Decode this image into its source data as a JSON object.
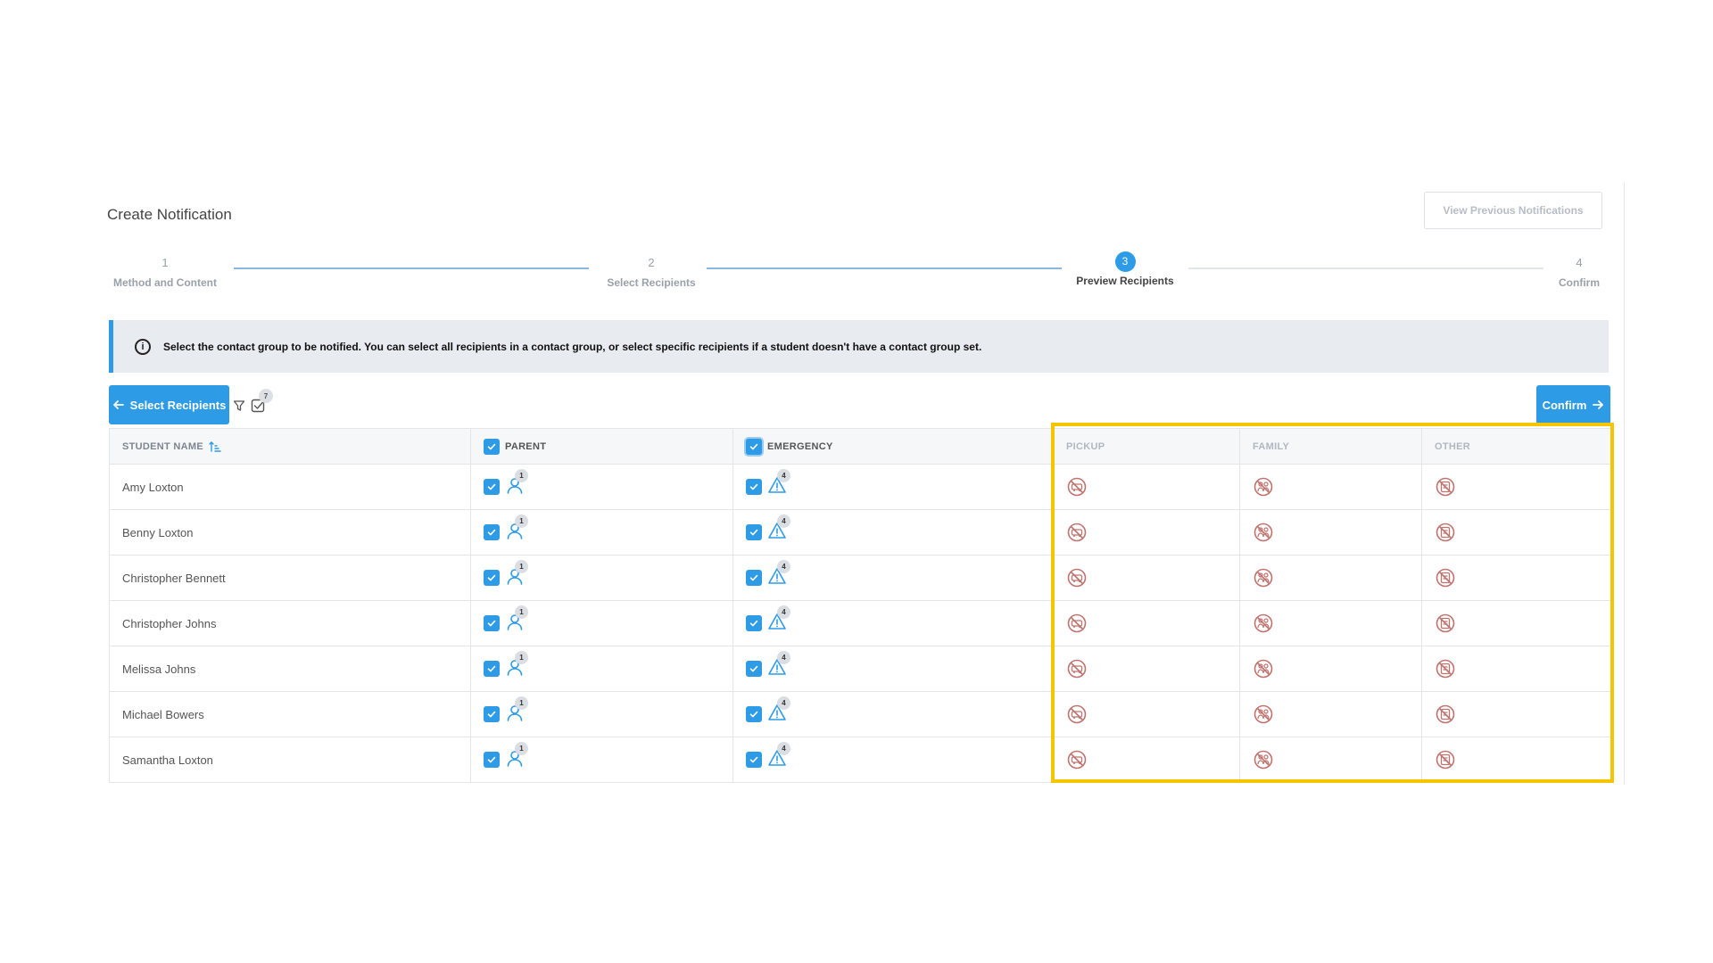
{
  "page": {
    "title": "Create Notification",
    "view_previous_label": "View Previous Notifications"
  },
  "stepper": {
    "steps": [
      {
        "number": "1",
        "label": "Method and Content",
        "state": "done"
      },
      {
        "number": "2",
        "label": "Select Recipients",
        "state": "done"
      },
      {
        "number": "3",
        "label": "Preview Recipients",
        "state": "active"
      },
      {
        "number": "4",
        "label": "Confirm",
        "state": "todo"
      }
    ]
  },
  "info": {
    "icon": "info-icon",
    "text": "Select the contact group to be notified. You can select all recipients in a contact group, or select specific recipients if a student doesn't have a contact group set."
  },
  "toolbar": {
    "back_label": "Select Recipients",
    "selected_count": "7",
    "confirm_label": "Confirm"
  },
  "table": {
    "headers": {
      "student": "STUDENT NAME",
      "parent": "PARENT",
      "emergency": "EMERGENCY",
      "pickup": "PICKUP",
      "family": "FAMILY",
      "other": "OTHER"
    },
    "rows": [
      {
        "name": "Amy Loxton",
        "parent_count": "1",
        "emergency_count": "4"
      },
      {
        "name": "Benny Loxton",
        "parent_count": "1",
        "emergency_count": "4"
      },
      {
        "name": "Christopher Bennett",
        "parent_count": "1",
        "emergency_count": "4"
      },
      {
        "name": "Christopher Johns",
        "parent_count": "1",
        "emergency_count": "4"
      },
      {
        "name": "Melissa Johns",
        "parent_count": "1",
        "emergency_count": "4"
      },
      {
        "name": "Michael Bowers",
        "parent_count": "1",
        "emergency_count": "4"
      },
      {
        "name": "Samantha Loxton",
        "parent_count": "1",
        "emergency_count": "4"
      }
    ]
  },
  "colors": {
    "accent": "#2d9be6",
    "no_contact_icon": "#c0736e",
    "highlight": "#f5c600"
  }
}
